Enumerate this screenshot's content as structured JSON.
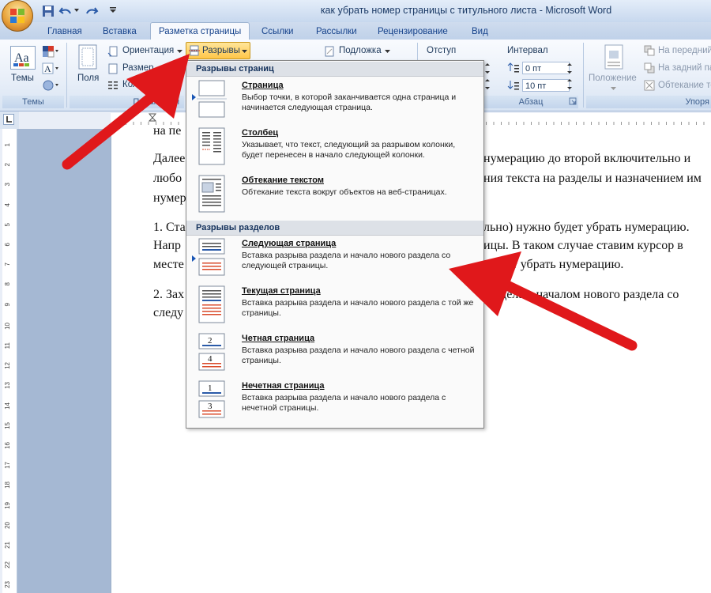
{
  "window": {
    "title": "как убрать номер страницы с титульного листа - Microsoft Word"
  },
  "tabs": [
    "Главная",
    "Вставка",
    "Разметка страницы",
    "Ссылки",
    "Рассылки",
    "Рецензирование",
    "Вид"
  ],
  "ribbon": {
    "themes": {
      "label": "Темы",
      "group": "Темы"
    },
    "fields_label": "Поля",
    "orientation": "Ориентация",
    "size": "Размер",
    "columns": "Колон",
    "page_setup_group": "Параметры",
    "breaks": "Разрывы",
    "watermark": "Подложка",
    "indent": "Отступ",
    "interval": "Интервал",
    "spacing_before": "0 пт",
    "spacing_after": "10 пт",
    "paragraph_group": "Абзац",
    "position": "Положение",
    "bring_front": "На передний",
    "send_back": "На задний па",
    "wrap_text": "Обтекание те",
    "arrange_group": "Упоря"
  },
  "document": {
    "lines": [
      "на пе",
      "Далее",
      "нумерацию до второй включительно и",
      "любо",
      "ния текста на разделы и назначением им",
      "нумер",
      "1. Ста",
      "льно) нужно будет убрать нумерацию.",
      "Напр",
      "ицы. В таком случае ставим курсор в",
      "месте",
      "будет убрать нумерацию.",
      "2. Зах",
      "раздела с началом нового раздела со",
      "следу"
    ]
  },
  "menu": {
    "section1": "Разрывы страниц",
    "section2": "Разрывы разделов",
    "items": [
      {
        "title": "Страница",
        "desc": "Выбор точки, в которой заканчивается одна страница и начинается следующая страница."
      },
      {
        "title": "Столбец",
        "desc": "Указывает, что текст, следующий за разрывом колонки, будет перенесен в начало следующей колонки."
      },
      {
        "title": "Обтекание текстом",
        "desc": "Обтекание текста вокруг объектов на веб-страницах."
      },
      {
        "title": "Следующая страница",
        "desc": "Вставка разрыва раздела и начало нового раздела со следующей страницы."
      },
      {
        "title": "Текущая страница",
        "desc": "Вставка разрыва раздела и начало нового раздела с той же страницы."
      },
      {
        "title": "Четная страница",
        "desc": "Вставка разрыва раздела и начало нового раздела с четной страницы."
      },
      {
        "title": "Нечетная страница",
        "desc": "Вставка разрыва раздела и начало нового раздела с нечетной страницы."
      }
    ]
  },
  "thumbs": {
    "even_top": "2",
    "even_bottom": "4",
    "odd_top": "1",
    "odd_bottom": "3"
  },
  "ruler_v": [
    "1",
    "2",
    "3",
    "4",
    "5",
    "6",
    "7",
    "8",
    "9",
    "10",
    "11",
    "12",
    "13",
    "14",
    "15",
    "16",
    "17",
    "18",
    "19",
    "20",
    "21",
    "22",
    "23"
  ],
  "colors": {
    "arrow": "#e0181b",
    "accent": "#1a56b5",
    "highlight": "#ffc649"
  }
}
